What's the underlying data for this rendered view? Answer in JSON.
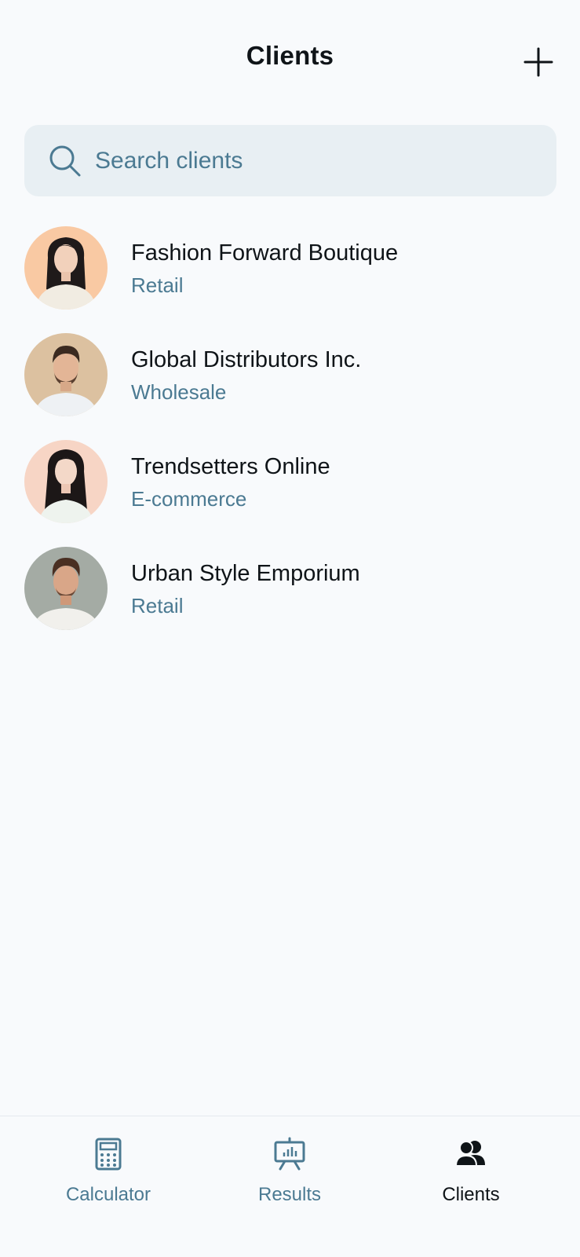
{
  "header": {
    "title": "Clients",
    "add_icon": "plus-icon"
  },
  "search": {
    "placeholder": "Search clients",
    "value": "",
    "icon": "search-icon"
  },
  "clients": [
    {
      "name": "Fashion Forward Boutique",
      "category": "Retail",
      "avatar": "woman-avatar"
    },
    {
      "name": "Global Distributors Inc.",
      "category": "Wholesale",
      "avatar": "man-avatar"
    },
    {
      "name": "Trendsetters Online",
      "category": "E-commerce",
      "avatar": "woman-avatar"
    },
    {
      "name": "Urban Style Emporium",
      "category": "Retail",
      "avatar": "man-avatar"
    }
  ],
  "bottom_nav": {
    "items": [
      {
        "label": "Calculator",
        "icon": "calculator-icon",
        "active": false
      },
      {
        "label": "Results",
        "icon": "presentation-chart-icon",
        "active": false
      },
      {
        "label": "Clients",
        "icon": "users-icon",
        "active": true
      }
    ]
  },
  "colors": {
    "background": "#f8fafc",
    "search_background": "#e8eff3",
    "primary_text": "#0f1418",
    "secondary_text": "#4b7a92"
  }
}
